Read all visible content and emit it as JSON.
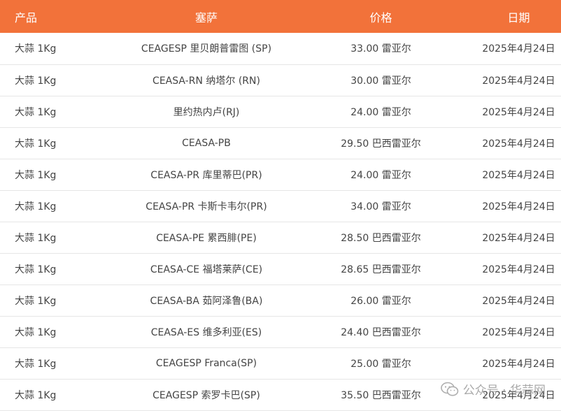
{
  "table": {
    "headers": {
      "product": "产品",
      "market": "塞萨",
      "price": "价格",
      "date": "日期"
    },
    "rows": [
      {
        "product": "大蒜 1Kg",
        "market": "CEAGESP 里贝朗普雷图 (SP)",
        "price": "33.00 雷亚尔",
        "date": "2025年4月24日"
      },
      {
        "product": "大蒜 1Kg",
        "market": "CEASA-RN 纳塔尔 (RN)",
        "price": "30.00 雷亚尔",
        "date": "2025年4月24日"
      },
      {
        "product": "大蒜 1Kg",
        "market": "里约热内卢(RJ)",
        "price": "24.00 雷亚尔",
        "date": "2025年4月24日"
      },
      {
        "product": "大蒜 1Kg",
        "market": "CEASA-PB",
        "price": "29.50 巴西雷亚尔",
        "date": "2025年4月24日"
      },
      {
        "product": "大蒜 1Kg",
        "market": "CEASA-PR 库里蒂巴(PR)",
        "price": "24.00 雷亚尔",
        "date": "2025年4月24日"
      },
      {
        "product": "大蒜 1Kg",
        "market": "CEASA-PR 卡斯卡韦尔(PR)",
        "price": "34.00 雷亚尔",
        "date": "2025年4月24日"
      },
      {
        "product": "大蒜 1Kg",
        "market": "CEASA-PE 累西腓(PE)",
        "price": "28.50 巴西雷亚尔",
        "date": "2025年4月24日"
      },
      {
        "product": "大蒜 1Kg",
        "market": "CEASA-CE 福塔莱萨(CE)",
        "price": "28.65 巴西雷亚尔",
        "date": "2025年4月24日"
      },
      {
        "product": "大蒜 1Kg",
        "market": "CEASA-BA 茹阿泽鲁(BA)",
        "price": "26.00 雷亚尔",
        "date": "2025年4月24日"
      },
      {
        "product": "大蒜 1Kg",
        "market": "CEASA-ES 维多利亚(ES)",
        "price": "24.40 巴西雷亚尔",
        "date": "2025年4月24日"
      },
      {
        "product": "大蒜 1Kg",
        "market": "CEAGESP Franca(SP)",
        "price": "25.00 雷亚尔",
        "date": "2025年4月24日"
      },
      {
        "product": "大蒜 1Kg",
        "market": "CEAGESP 索罗卡巴(SP)",
        "price": "35.50 巴西雷亚尔",
        "date": "2025年4月24日"
      }
    ]
  },
  "watermark": {
    "text": "公众号 · 华蒜网",
    "icon": "wechat-icon"
  },
  "colors": {
    "header_bg": "#f2723a",
    "header_text": "#ffffff",
    "row_divider": "#e6e6e6",
    "body_text": "#444444"
  }
}
